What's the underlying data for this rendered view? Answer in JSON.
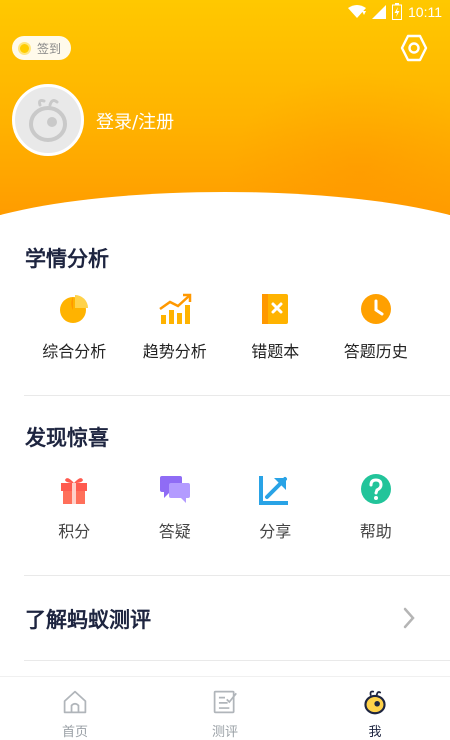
{
  "status_bar": {
    "time": "10:11"
  },
  "header": {
    "signin_label": "签到",
    "login_label": "登录/注册"
  },
  "sections": {
    "analysis": {
      "title": "学情分析",
      "items": [
        {
          "label": "综合分析",
          "icon": "pie-chart-icon"
        },
        {
          "label": "趋势分析",
          "icon": "trend-chart-icon"
        },
        {
          "label": "错题本",
          "icon": "wrong-book-icon"
        },
        {
          "label": "答题历史",
          "icon": "clock-icon"
        }
      ]
    },
    "discover": {
      "title": "发现惊喜",
      "items": [
        {
          "label": "积分",
          "icon": "gift-icon"
        },
        {
          "label": "答疑",
          "icon": "chat-icon"
        },
        {
          "label": "分享",
          "icon": "share-icon"
        },
        {
          "label": "帮助",
          "icon": "help-icon"
        }
      ]
    }
  },
  "about": {
    "label": "了解蚂蚁测评"
  },
  "tabbar": {
    "tabs": [
      {
        "label": "首页",
        "icon": "home-icon"
      },
      {
        "label": "测评",
        "icon": "assessment-icon"
      },
      {
        "label": "我",
        "icon": "profile-icon",
        "active": true
      }
    ]
  },
  "colors": {
    "header_top": "#ffc800",
    "header_bottom": "#ff9c00",
    "accent_orange": "#ffa000",
    "chat_purple": "#8f6cf5",
    "share_blue": "#29a3e6",
    "help_green": "#22c49a",
    "gift_red": "#ff5a4f"
  }
}
